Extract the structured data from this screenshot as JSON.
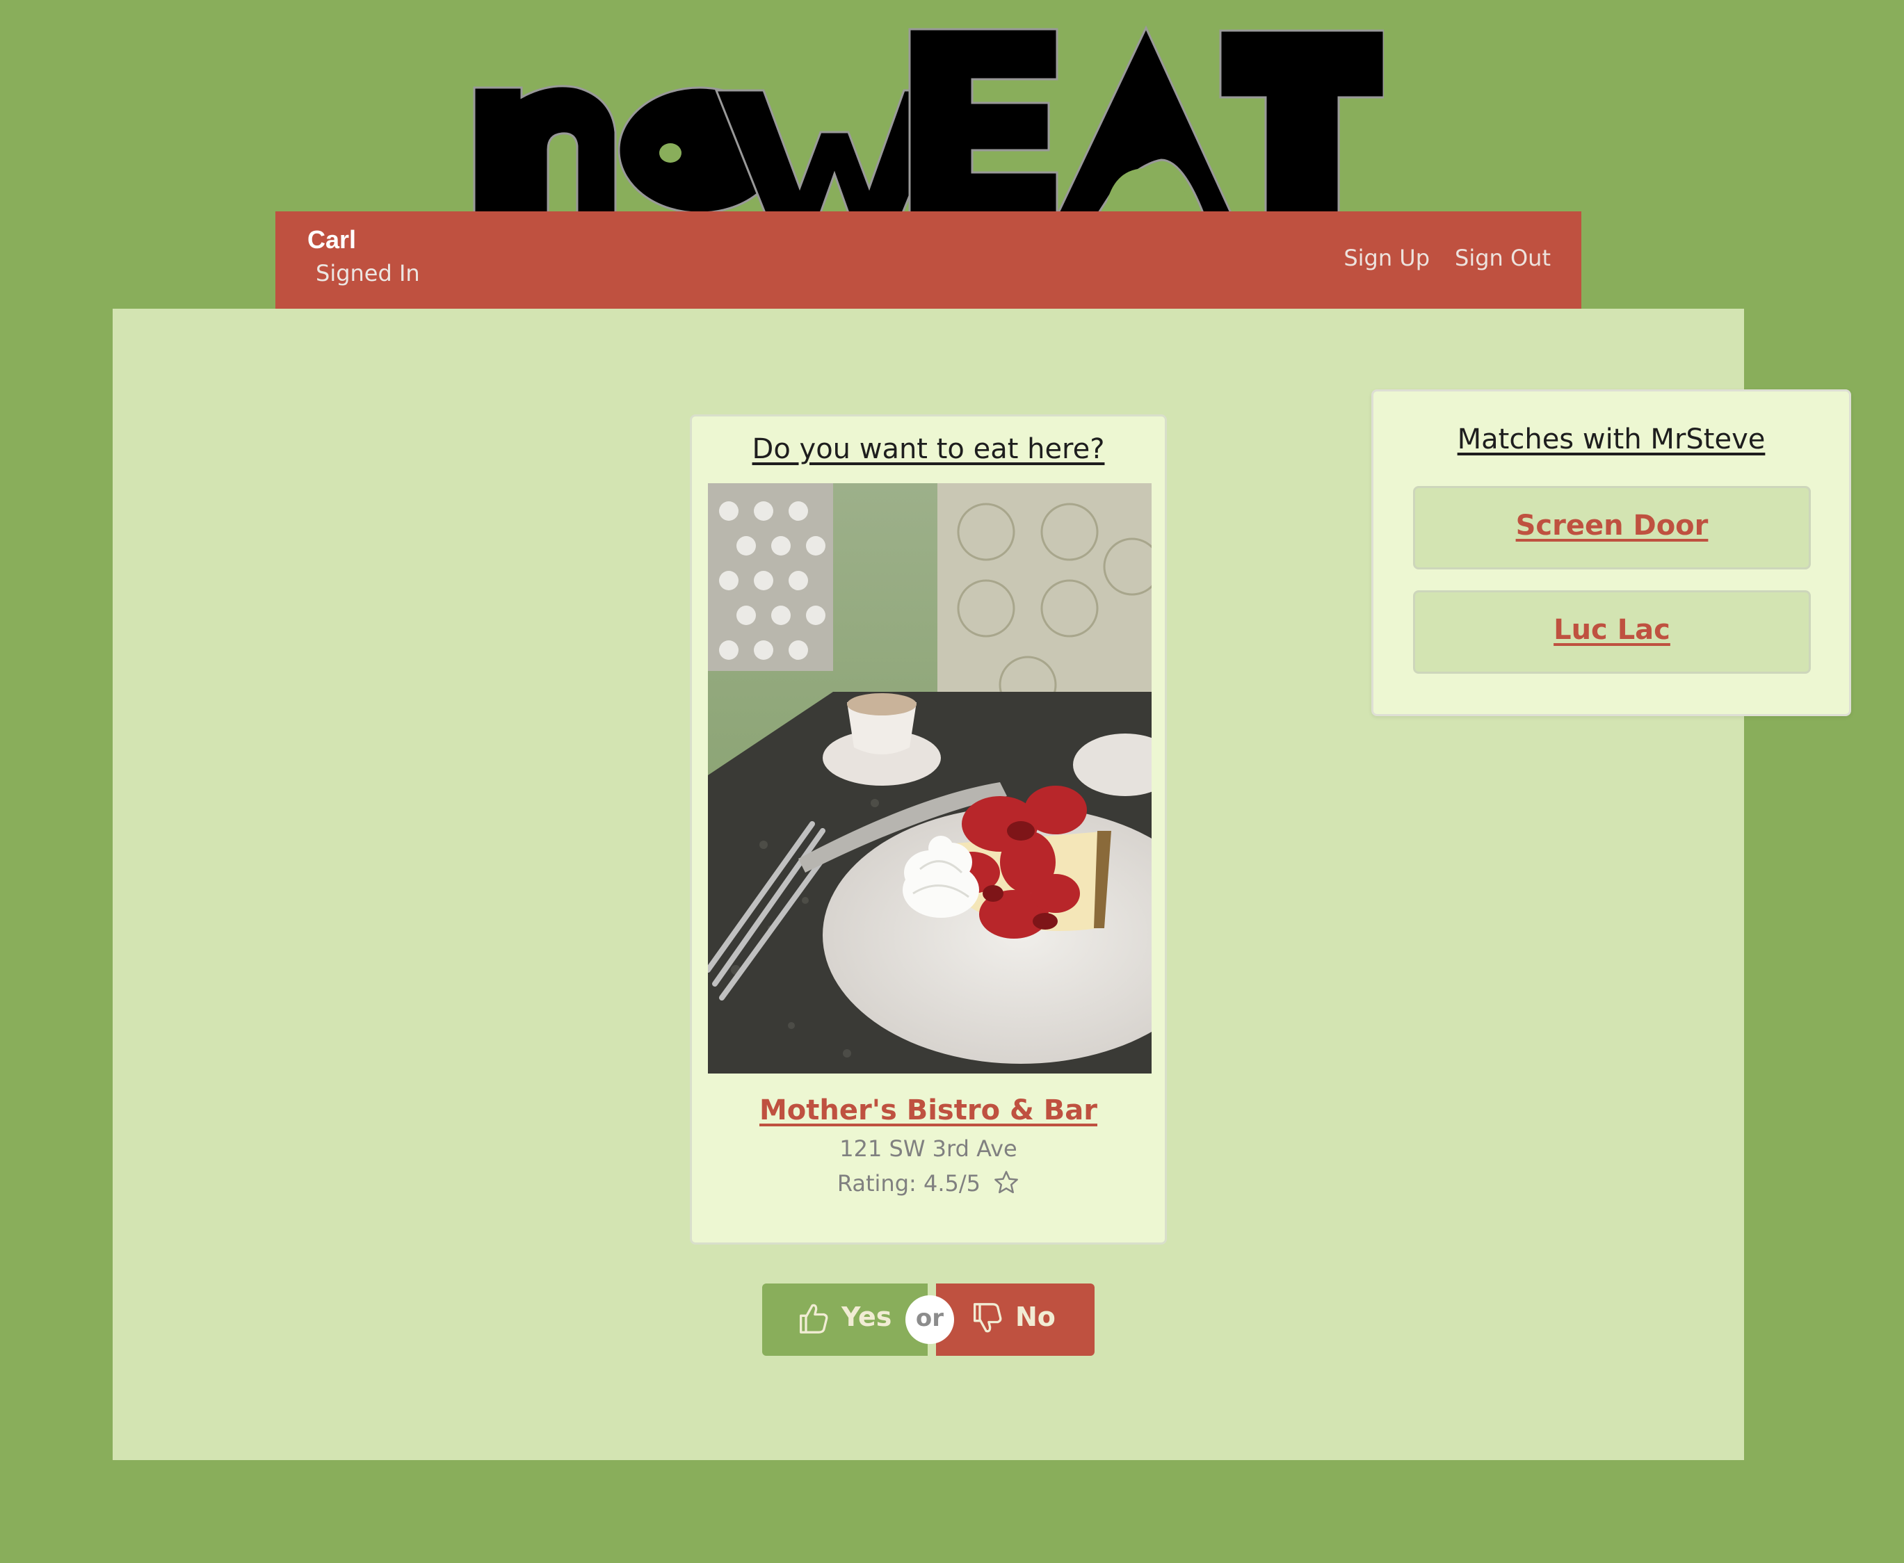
{
  "app": {
    "logo_text": "nowEAT"
  },
  "navbar": {
    "user_name": "Carl",
    "user_status": "Signed In",
    "links": [
      "Sign Up",
      "Sign Out"
    ]
  },
  "card": {
    "question": "Do you want to eat here?",
    "restaurant_name": "Mother's Bistro & Bar",
    "address": "121 SW 3rd Ave",
    "rating": "Rating: 4.5/5",
    "rating_icon": "star-outline-icon",
    "photo_subject": "cheesecake-with-strawberries-photo"
  },
  "actions": {
    "yes_label": "Yes",
    "yes_icon": "thumbs-up-icon",
    "or_label": "or",
    "no_label": "No",
    "no_icon": "thumbs-down-icon"
  },
  "matches": {
    "title": "Matches with MrSteve",
    "items": [
      "Screen Door",
      "Luc Lac"
    ]
  },
  "colors": {
    "page_background": "#89ae5b",
    "content_background": "#d3e4b2",
    "card_background": "#edf7d2",
    "accent_red": "#bf5140",
    "accent_green": "#89ae5b"
  }
}
